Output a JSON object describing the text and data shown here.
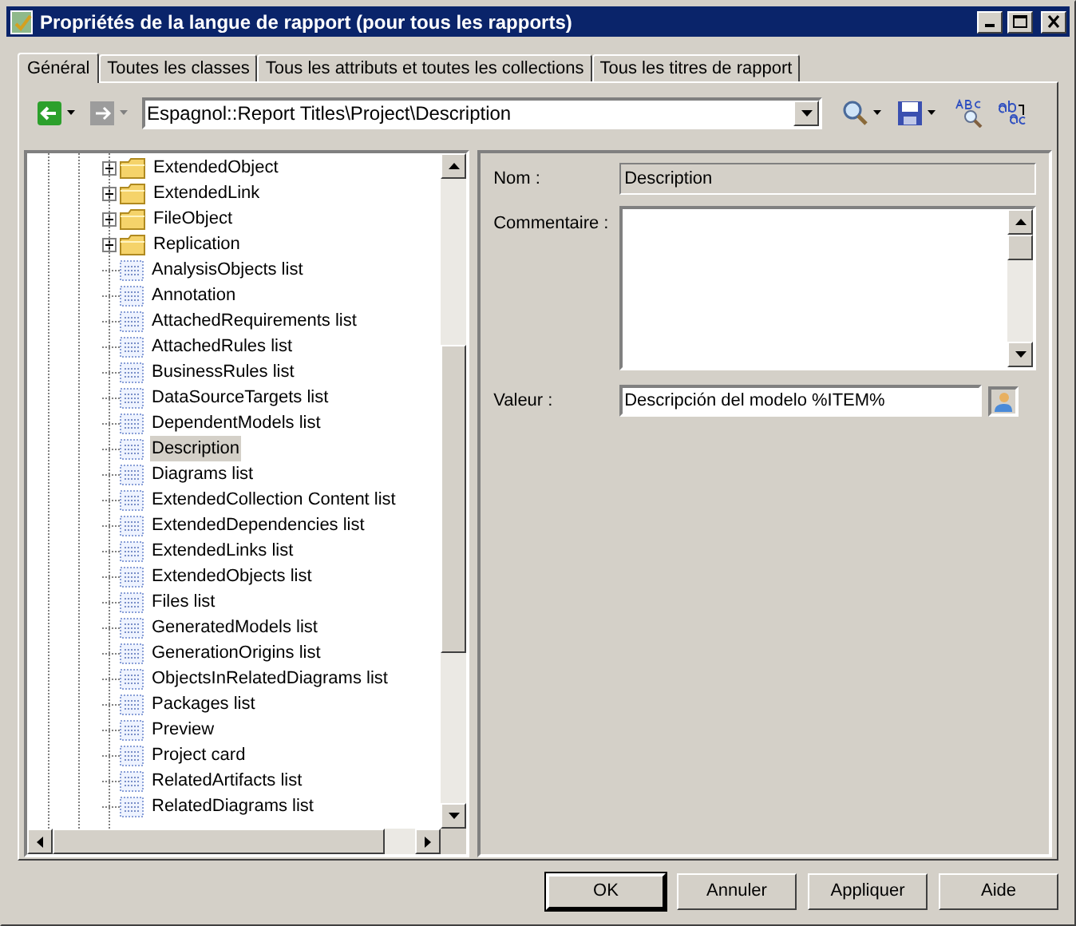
{
  "window": {
    "title": "Propriétés de la langue de rapport (pour tous les rapports)"
  },
  "tabs": [
    {
      "label": "Général",
      "selected": true
    },
    {
      "label": "Toutes les classes",
      "selected": false
    },
    {
      "label": "Tous les attributs et toutes les collections",
      "selected": false
    },
    {
      "label": "Tous les titres de rapport",
      "selected": false
    }
  ],
  "toolbar": {
    "path": "Espagnol::Report Titles\\Project\\Description",
    "back_disabled": false,
    "forward_disabled": true
  },
  "tree": {
    "items": [
      {
        "label": "ExtendedObject",
        "kind": "folder",
        "selected": false
      },
      {
        "label": "ExtendedLink",
        "kind": "folder",
        "selected": false
      },
      {
        "label": "FileObject",
        "kind": "folder",
        "selected": false
      },
      {
        "label": "Replication",
        "kind": "folder",
        "selected": false
      },
      {
        "label": "AnalysisObjects list",
        "kind": "item",
        "selected": false
      },
      {
        "label": "Annotation",
        "kind": "item",
        "selected": false
      },
      {
        "label": "AttachedRequirements list",
        "kind": "item",
        "selected": false
      },
      {
        "label": "AttachedRules list",
        "kind": "item",
        "selected": false
      },
      {
        "label": "BusinessRules list",
        "kind": "item",
        "selected": false
      },
      {
        "label": "DataSourceTargets list",
        "kind": "item",
        "selected": false
      },
      {
        "label": "DependentModels list",
        "kind": "item",
        "selected": false
      },
      {
        "label": "Description",
        "kind": "item",
        "selected": true
      },
      {
        "label": "Diagrams list",
        "kind": "item",
        "selected": false
      },
      {
        "label": "ExtendedCollection Content list",
        "kind": "item",
        "selected": false
      },
      {
        "label": "ExtendedDependencies list",
        "kind": "item",
        "selected": false
      },
      {
        "label": "ExtendedLinks list",
        "kind": "item",
        "selected": false
      },
      {
        "label": "ExtendedObjects list",
        "kind": "item",
        "selected": false
      },
      {
        "label": "Files list",
        "kind": "item",
        "selected": false
      },
      {
        "label": "GeneratedModels list",
        "kind": "item",
        "selected": false
      },
      {
        "label": "GenerationOrigins list",
        "kind": "item",
        "selected": false
      },
      {
        "label": "ObjectsInRelatedDiagrams list",
        "kind": "item",
        "selected": false
      },
      {
        "label": "Packages list",
        "kind": "item",
        "selected": false
      },
      {
        "label": "Preview",
        "kind": "item",
        "selected": false
      },
      {
        "label": "Project card",
        "kind": "item",
        "selected": false
      },
      {
        "label": "RelatedArtifacts list",
        "kind": "item",
        "selected": false
      },
      {
        "label": "RelatedDiagrams list",
        "kind": "item",
        "selected": false
      }
    ]
  },
  "form": {
    "name_label": "Nom :",
    "name_value": "Description",
    "comment_label": "Commentaire :",
    "value_label": "Valeur :",
    "value": "Descripción del modelo %ITEM%"
  },
  "buttons": [
    {
      "label": "OK",
      "default": true
    },
    {
      "label": "Annuler",
      "default": false
    },
    {
      "label": "Appliquer",
      "default": false
    },
    {
      "label": "Aide",
      "default": false
    }
  ]
}
